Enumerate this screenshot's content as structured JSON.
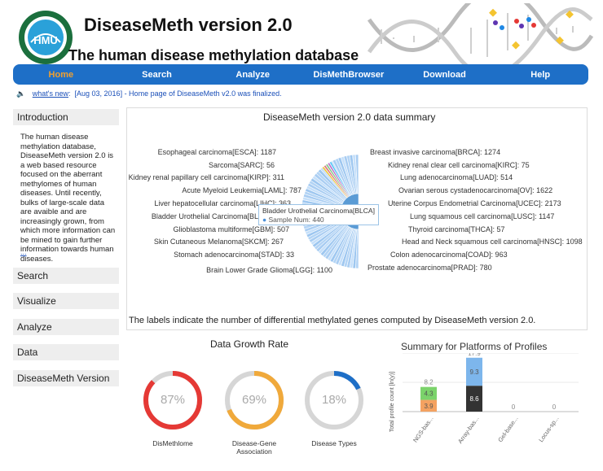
{
  "header": {
    "title": "DiseaseMeth version 2.0",
    "subtitle": "The human disease methylation database",
    "logo_text": "HMU"
  },
  "nav": {
    "items": [
      {
        "label": "Home",
        "active": true
      },
      {
        "label": "Search",
        "active": false
      },
      {
        "label": "Analyze",
        "active": false
      },
      {
        "label": "DisMethBrowser",
        "active": false
      },
      {
        "label": "Download",
        "active": false
      },
      {
        "label": "Help",
        "active": false
      }
    ]
  },
  "news": {
    "link": "what's new",
    "text": "[Aug 03, 2016] - Home page of DiseaseMeth v2.0 was finalized."
  },
  "sidebar": {
    "introduction": "Introduction",
    "intro_text": "The human disease methylation database, DiseaseMeth version 2.0 is a web based resource focused on the aberrant methylomes of human diseases. Until recently, bulks of large-scale data are avaible and are increasingly grown, from which more information can be mined to gain further information towards human diseases.",
    "more": "...",
    "items": [
      "Search",
      "Visualize",
      "Analyze",
      "Data",
      "DiseaseMeth Version"
    ]
  },
  "summary": {
    "title": "DiseaseMeth version 2.0 data summary",
    "left_labels": [
      "Esophageal carcinoma[ESCA]: 1187",
      "Sarcoma[SARC]: 56",
      "Kidney renal papillary cell carcinoma[KIRP]: 311",
      "Acute Myeloid Leukemia[LAML]: 787",
      "Liver hepatocellular carcinoma[LIHC]: 363",
      "Bladder Urothelial Carcinoma[BLCA]: 440",
      "Glioblastoma multiforme[GBM]: 507",
      "Skin Cutaneous Melanoma[SKCM]: 267",
      "Stomach adenocarcinoma[STAD]: 33",
      "Brain Lower Grade Glioma[LGG]: 1100"
    ],
    "right_labels": [
      "Breast invasive carcinoma[BRCA]: 1274",
      "Kidney renal clear cell carcinoma[KIRC]: 75",
      "Lung adenocarcinoma[LUAD]: 514",
      "Ovarian serous cystadenocarcinoma[OV]: 1622",
      "Uterine Corpus Endometrial Carcinoma[UCEC]: 2173",
      "Lung squamous cell carcinoma[LUSC]: 1147",
      "Thyroid carcinoma[THCA]: 57",
      "Head and Neck squamous cell carcinoma[HNSC]: 1098",
      "Colon adenocarcinoma[COAD]: 963",
      "Prostate adenocarcinoma[PRAD]: 780"
    ],
    "tooltip_title": "Bladder Urothelial Carcinoma[BLCA]",
    "tooltip_value": "Sample Num: 440",
    "note": "The labels indicate the number of differential methylated genes computed by DiseaseMeth version 2.0."
  },
  "growth": {
    "title": "Data Growth Rate",
    "gauges": [
      {
        "value": "87%",
        "label": "DisMethlome",
        "fraction": 0.87,
        "color": "#e53935"
      },
      {
        "value": "69%",
        "label": "Disease-Gene Association",
        "fraction": 0.69,
        "color": "#f0a93b"
      },
      {
        "value": "18%",
        "label": "Disease Types",
        "fraction": 0.18,
        "color": "#1e6fc7"
      }
    ]
  },
  "chart_data": {
    "type": "bar",
    "title": "Summary for Platforms of Profiles",
    "ylabel": "Total profile count [ln(y)]",
    "categories": [
      "NGS-bas...",
      "Array-bas...",
      "Gel-base...",
      "Locus-sp..."
    ],
    "stacks": [
      {
        "category": "NGS-bas...",
        "total": "8.2",
        "segments": [
          {
            "value": 3.9,
            "color": "#f4a261"
          },
          {
            "value": 4.3,
            "color": "#7bd36b"
          }
        ]
      },
      {
        "category": "Array-bas...",
        "total": "17.9",
        "segments": [
          {
            "value": 8.6,
            "color": "#333333"
          },
          {
            "value": 9.3,
            "color": "#7db6ec"
          }
        ]
      },
      {
        "category": "Gel-base...",
        "total": "0",
        "segments": []
      },
      {
        "category": "Locus-sp...",
        "total": "0",
        "segments": []
      }
    ],
    "colors": {
      "orange": "#f4a261",
      "green": "#7bd36b",
      "black": "#333333",
      "blue": "#7db6ec"
    }
  }
}
